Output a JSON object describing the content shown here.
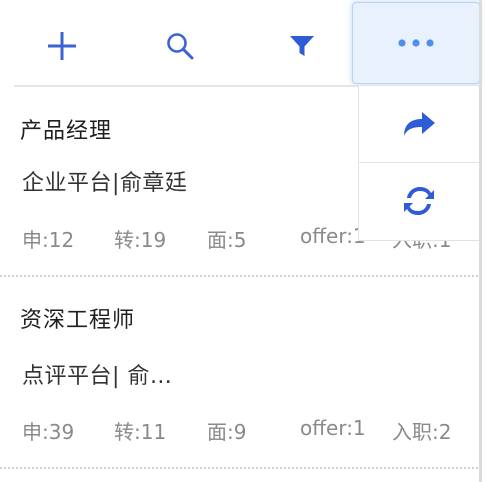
{
  "colors": {
    "accent": "#2e5bd6",
    "icon_blue": "#3a63d6",
    "more_bg": "#e9f1fd",
    "dots": "#4f8ff0",
    "title_text": "#1f1f1f",
    "stat_text": "#8a8a8a"
  },
  "toolbar": {
    "add_icon": "plus-icon",
    "search_icon": "search-icon",
    "filter_icon": "filter-icon",
    "more_icon": "more-dots-icon"
  },
  "menu": {
    "share_icon": "share-icon",
    "refresh_icon": "refresh-icon"
  },
  "cards": [
    {
      "title": "产品经理",
      "subtitle": "企业平台|俞章廷",
      "stats": {
        "apply": "申:12",
        "transfer": "转:19",
        "interview": "面:5",
        "offer": "offer:1",
        "hired": "入职:1"
      }
    },
    {
      "title": "资深工程师",
      "subtitle": "点评平台| 俞…",
      "stats": {
        "apply": "申:39",
        "transfer": "转:11",
        "interview": "面:9",
        "offer": "offer:1",
        "hired": "入职:2"
      }
    }
  ]
}
